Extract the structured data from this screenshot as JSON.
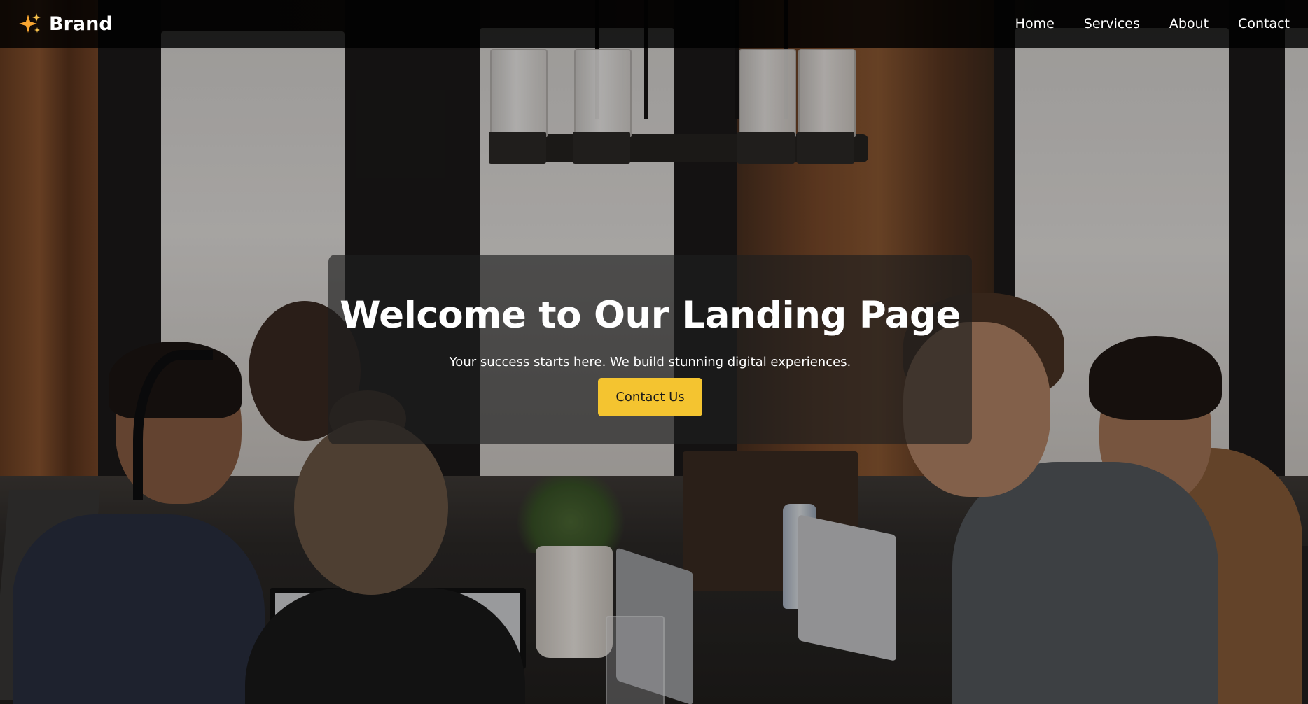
{
  "navbar": {
    "brand_icon": "sparkles-icon",
    "brand_name": "Brand",
    "links": [
      {
        "label": "Home"
      },
      {
        "label": "Services"
      },
      {
        "label": "About"
      },
      {
        "label": "Contact"
      }
    ]
  },
  "hero": {
    "background": "coworking-photo",
    "title": "Welcome to Our Landing Page",
    "subtitle": "Your success starts here. We build stunning digital experiences.",
    "cta_label": "Contact Us"
  },
  "colors": {
    "accent": "#f4c430",
    "navbar_bg": "#000000",
    "text": "#ffffff"
  }
}
